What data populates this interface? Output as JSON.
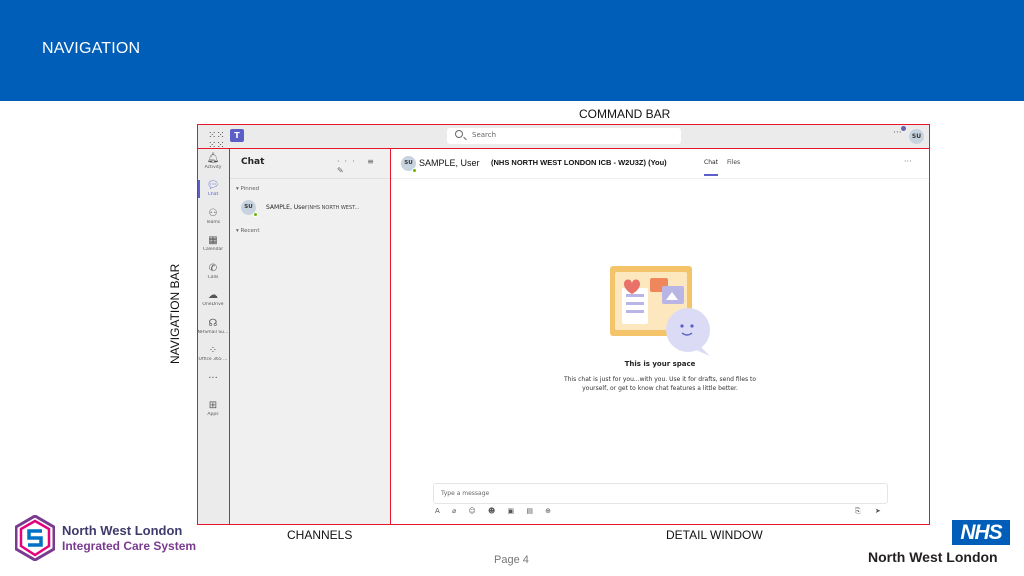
{
  "slide": {
    "title": "NAVIGATION",
    "page": "Page 4",
    "callouts": {
      "command_bar": "COMMAND BAR",
      "navigation_bar": "NAVIGATION BAR",
      "channels": "CHANNELS",
      "detail_window": "DETAIL WINDOW"
    },
    "colors": {
      "header": "#005EB8",
      "highlight_box": "#e8162a",
      "teams_accent": "#5b5fc7"
    }
  },
  "teams": {
    "search_placeholder": "Search",
    "top_more": "···",
    "user_initials": "SU",
    "rail": [
      {
        "label": "Activity",
        "icon": "bell-icon",
        "glyph": "🔔︎"
      },
      {
        "label": "Chat",
        "icon": "chat-icon",
        "glyph": "💬︎"
      },
      {
        "label": "Teams",
        "icon": "teams-icon",
        "glyph": "⚇"
      },
      {
        "label": "Calendar",
        "icon": "calendar-icon",
        "glyph": "▦"
      },
      {
        "label": "Calls",
        "icon": "phone-icon",
        "glyph": "✆"
      },
      {
        "label": "OneDrive",
        "icon": "cloud-icon",
        "glyph": "☁"
      },
      {
        "label": "NHSmail Su...",
        "icon": "headset-icon",
        "glyph": "☊"
      },
      {
        "label": "Office 365 ...",
        "icon": "office-icon",
        "glyph": "⁘"
      },
      {
        "label": "",
        "icon": "more-icon",
        "glyph": "···"
      },
      {
        "label": "Apps",
        "icon": "apps-icon",
        "glyph": "⊞"
      }
    ],
    "chatlist": {
      "title": "Chat",
      "tools": "··· ≡ ✎",
      "pinned_label": "▾ Pinned",
      "recent_label": "▾ Recent",
      "pinned_item": {
        "initials": "SU",
        "name": "SAMPLE, User",
        "sub": "(NHS NORTH WEST..."
      }
    },
    "detail": {
      "initials": "SU",
      "name": "SAMPLE, User",
      "org": "(NHS NORTH WEST LONDON ICB - W2U3Z) (You)",
      "tabs": [
        "Chat",
        "Files"
      ],
      "more": "···",
      "space_title": "This is your space",
      "space_text": "This chat is just for you...with you. Use it for drafts, send files to yourself, or get to know chat features a little better.",
      "compose_placeholder": "Type a message",
      "compose_tools": "A ⌀ ☺ ☻ ▣ ▤ ⊕",
      "compose_right": "⎘ ➤"
    }
  },
  "logos": {
    "icb_line1": "North West London",
    "icb_line2": "Integrated Care System",
    "nhs_mark": "NHS",
    "nhs_region": "North West London"
  }
}
